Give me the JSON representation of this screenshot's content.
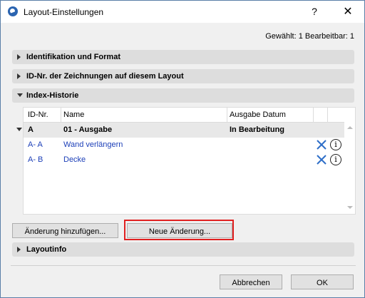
{
  "window": {
    "title": "Layout-Einstellungen",
    "help": "?",
    "close": "✕"
  },
  "status": "Gewählt: 1 Bearbeitbar: 1",
  "sections": {
    "identification": "Identifikation und Format",
    "drawing_ids": "ID-Nr. der Zeichnungen auf diesem Layout",
    "index_history": "Index-Historie",
    "layoutinfo": "Layoutinfo"
  },
  "table": {
    "columns": [
      "ID-Nr.",
      "Name",
      "Ausgabe Datum"
    ],
    "group": {
      "id": "A",
      "name": "01 - Ausgabe",
      "date": "In Bearbeitung"
    },
    "rows": [
      {
        "id": "A- A",
        "name": "Wand verlängern"
      },
      {
        "id": "A- B",
        "name": "Decke"
      }
    ]
  },
  "buttons": {
    "add_change": "Änderung hinzufügen...",
    "new_change": "Neue Änderung...",
    "cancel": "Abbrechen",
    "ok": "OK"
  },
  "colors": {
    "link": "#1c3fb8",
    "highlight": "#e02020",
    "delete_icon": "#2f6fc8"
  },
  "icons": {
    "delete": "close-x-icon",
    "info": "info-icon"
  }
}
